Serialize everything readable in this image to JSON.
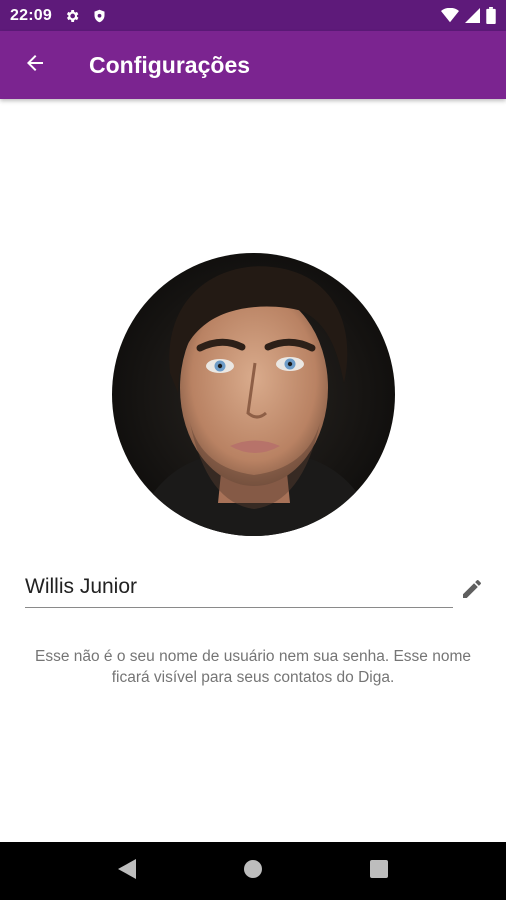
{
  "status_bar": {
    "time": "22:09",
    "left_icons": [
      "gear-icon",
      "shield-icon"
    ],
    "right_icons": [
      "wifi-icon",
      "signal-icon",
      "battery-icon"
    ],
    "background": "#5e1a7a"
  },
  "app_bar": {
    "title": "Configurações",
    "background": "#7b2490"
  },
  "profile": {
    "name_value": "Willis Junior",
    "helper_text": "Esse não é o seu nome de usuário nem sua senha. Esse nome ficará visível para seus contatos do Diga."
  },
  "nav_bar": {
    "buttons": [
      "back-triangle-icon",
      "home-circle-icon",
      "recents-square-icon"
    ]
  }
}
